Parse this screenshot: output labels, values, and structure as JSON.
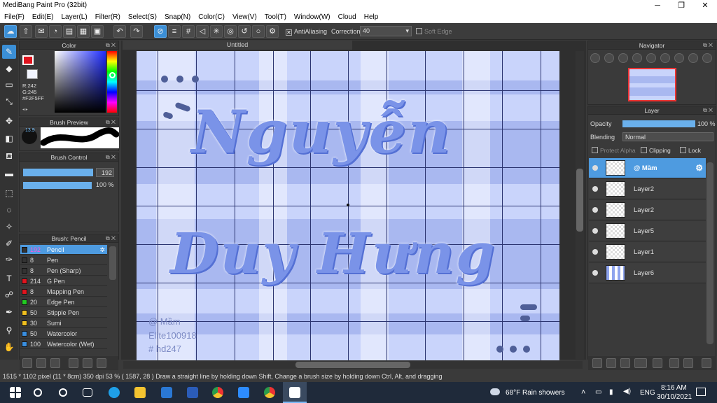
{
  "window": {
    "title": "MediBang Paint Pro (32bit)"
  },
  "menu": [
    "File(F)",
    "Edit(E)",
    "Layer(L)",
    "Filter(R)",
    "Select(S)",
    "Snap(N)",
    "Color(C)",
    "View(V)",
    "Tool(T)",
    "Window(W)",
    "Cloud",
    "Help"
  ],
  "toolbar": {
    "antialiasing": "AntiAliasing",
    "correction_label": "Correction",
    "correction_value": "40",
    "soft_edge": "Soft Edge"
  },
  "color_panel": {
    "title": "Color",
    "r": "R:242",
    "g": "G:245",
    "hex": "#F2F5FF",
    "primary": "#e0141e",
    "secondary": "#f2f5ff"
  },
  "brush_preview": {
    "title": "Brush Preview",
    "size": "13.9"
  },
  "brush_control": {
    "title": "Brush Control",
    "size": "192",
    "opacity": "100 %"
  },
  "brush_list": {
    "title": "Brush: Pencil",
    "items": [
      {
        "size": "192",
        "name": "Pencil",
        "color": "#333333"
      },
      {
        "size": "8",
        "name": "Pen",
        "color": "#333333"
      },
      {
        "size": "8",
        "name": "Pen (Sharp)",
        "color": "#333333"
      },
      {
        "size": "214",
        "name": "G Pen",
        "color": "#e0141e"
      },
      {
        "size": "8",
        "name": "Mapping Pen",
        "color": "#e0141e"
      },
      {
        "size": "20",
        "name": "Edge Pen",
        "color": "#22cc22"
      },
      {
        "size": "50",
        "name": "Stipple Pen",
        "color": "#f0c020"
      },
      {
        "size": "30",
        "name": "Sumi",
        "color": "#f0c020"
      },
      {
        "size": "50",
        "name": "Watercolor",
        "color": "#3a8fe0"
      },
      {
        "size": "100",
        "name": "Watercolor (Wet)",
        "color": "#3a8fe0"
      }
    ]
  },
  "canvas": {
    "tab": "Untitled",
    "line1": "Nguyễn",
    "line2": "Duy Hưng",
    "watermark": [
      "@ Mầm",
      "Elite100918",
      "# hd247"
    ]
  },
  "navigator": {
    "title": "Navigator"
  },
  "layer_panel": {
    "title": "Layer",
    "opacity_label": "Opacity",
    "opacity_value": "100 %",
    "blending_label": "Blending",
    "blending_value": "Normal",
    "protect_alpha": "Protect Alpha",
    "clipping": "Clipping",
    "lock": "Lock",
    "layers": [
      "@ Mầm",
      "Layer2",
      "Layer2",
      "Layer5",
      "Layer1",
      "Layer6"
    ]
  },
  "status": {
    "text": "1515 * 1102 pixel  (11 * 8cm)  350 dpi  53 %  ( 1587, 28 )  Draw a straight line by holding down Shift, Change a brush size by holding down Ctrl, Alt, and dragging"
  },
  "taskbar": {
    "weather": "68°F  Rain showers",
    "lang": "ENG",
    "time": "8:16 AM",
    "date": "30/10/2021"
  }
}
